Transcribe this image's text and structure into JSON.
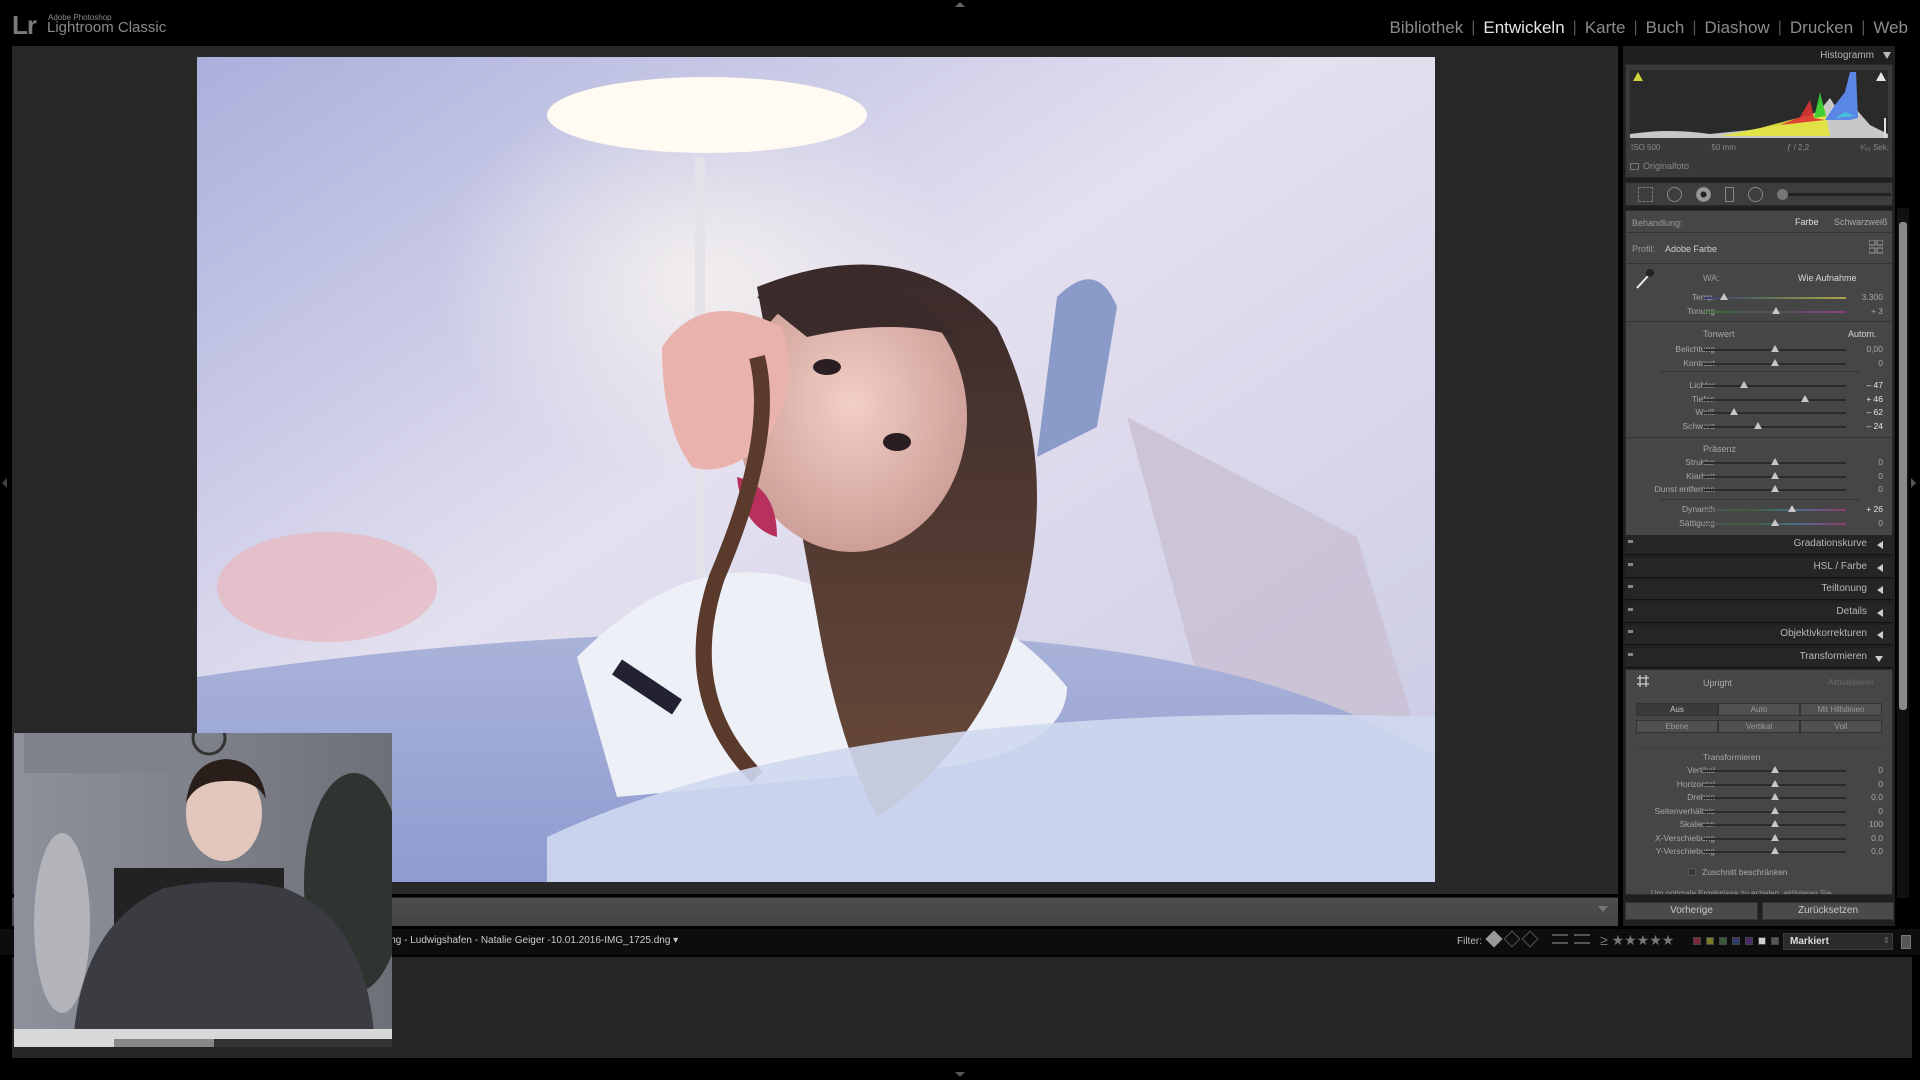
{
  "app": {
    "logo": "Lr",
    "vendor": "Adobe Photoshop",
    "product": "Lightroom Classic"
  },
  "modules": [
    {
      "label": "Bibliothek",
      "active": false
    },
    {
      "label": "Entwickeln",
      "active": true
    },
    {
      "label": "Karte",
      "active": false
    },
    {
      "label": "Buch",
      "active": false
    },
    {
      "label": "Diashow",
      "active": false
    },
    {
      "label": "Drucken",
      "active": false
    },
    {
      "label": "Web",
      "active": false
    }
  ],
  "histogram": {
    "title": "Histogramm",
    "iso": "ISO 500",
    "focal": "50 mm",
    "aperture": "ƒ / 2,2",
    "shutter": "¹⁄₅₀ Sek.",
    "original_label": "Originalfoto"
  },
  "basic": {
    "treatment_label": "Behandlung:",
    "treatment_color": "Farbe",
    "treatment_bw": "Schwarzweiß",
    "profile_label": "Profil:",
    "profile_value": "Adobe Farbe",
    "wb_label": "WA:",
    "wb_value": "Wie Aufnahme",
    "wb_sliders": [
      {
        "label": "Temp.",
        "value": "3.300",
        "pos": 0.15
      },
      {
        "label": "Tonung",
        "value": "+ 3",
        "pos": 0.51
      }
    ],
    "tone_label": "Tonwert",
    "auto_label": "Autom.",
    "tone_sliders": [
      {
        "label": "Belichtung",
        "value": "0,00",
        "pos": 0.5,
        "bold": false
      },
      {
        "label": "Kontrast",
        "value": "0",
        "pos": 0.5,
        "bold": false
      }
    ],
    "tone_sliders2": [
      {
        "label": "Lichter",
        "value": "– 47",
        "pos": 0.285,
        "bold": true
      },
      {
        "label": "Tiefen",
        "value": "+ 46",
        "pos": 0.71,
        "bold": true
      },
      {
        "label": "Weiß",
        "value": "– 62",
        "pos": 0.215,
        "bold": true
      },
      {
        "label": "Schwarz",
        "value": "– 24",
        "pos": 0.385,
        "bold": true
      }
    ],
    "presence_label": "Präsenz",
    "presence_sliders": [
      {
        "label": "Struktur",
        "value": "0",
        "pos": 0.5
      },
      {
        "label": "Klarheit",
        "value": "0",
        "pos": 0.5
      },
      {
        "label": "Dunst entfernen",
        "value": "0",
        "pos": 0.5
      }
    ],
    "presence_sliders2": [
      {
        "label": "Dynamik",
        "value": "+ 26",
        "pos": 0.62,
        "bold": true
      },
      {
        "label": "Sättigung",
        "value": "0",
        "pos": 0.5,
        "bold": false
      }
    ]
  },
  "sections": [
    {
      "label": "Gradationskurve",
      "expanded": false
    },
    {
      "label": "HSL / Farbe",
      "expanded": false
    },
    {
      "label": "Teiltonung",
      "expanded": false
    },
    {
      "label": "Details",
      "expanded": false
    },
    {
      "label": "Objektivkorrekturen",
      "expanded": false
    },
    {
      "label": "Transformieren",
      "expanded": true
    }
  ],
  "transform": {
    "upright_label": "Upright",
    "update_label": "Aktualisieren",
    "upright_buttons": [
      "Aus",
      "Auto",
      "Mit Hilfslinien",
      "Ebene",
      "Vertikal",
      "Voll"
    ],
    "upright_active": "Aus",
    "sub_label": "Transformieren",
    "sliders": [
      {
        "label": "Vertikal",
        "value": "0"
      },
      {
        "label": "Horizontal",
        "value": "0"
      },
      {
        "label": "Drehen",
        "value": "0,0"
      },
      {
        "label": "Seitenverhältnis",
        "value": "0"
      },
      {
        "label": "Skalieren",
        "value": "100"
      },
      {
        "label": "X-Verschiebung",
        "value": "0,0"
      },
      {
        "label": "Y-Verschiebung",
        "value": "0,0"
      }
    ],
    "constrain_label": "Zuschnitt beschränken",
    "hint": "Um optimale Ergebnisse zu erzielen, aktivieren Sie"
  },
  "buttons": {
    "previous": "Vorherige",
    "reset": "Zurücksetzen"
  },
  "filmstrip": {
    "path": "ing - Ludwigshafen - Natalie Geiger -10.01.2016-IMG_1725.dng ▾",
    "filter_label": "Filter:",
    "stars": "≥ ★★★★★",
    "filter_value": "Markiert",
    "color_labels": [
      "#7a2a3a",
      "#7a7a2a",
      "#3a5a3a",
      "#2a3a6a",
      "#4a2a6a",
      "#cccccc",
      "#555555"
    ]
  }
}
